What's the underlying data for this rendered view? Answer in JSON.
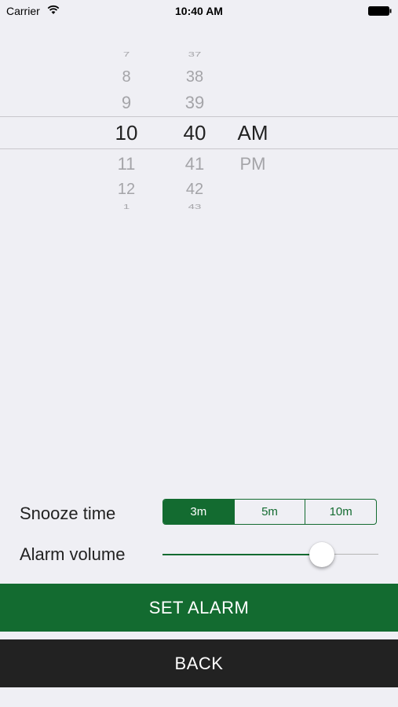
{
  "status_bar": {
    "carrier": "Carrier",
    "time": "10:40 AM"
  },
  "picker": {
    "hours": [
      "7",
      "8",
      "9",
      "10",
      "11",
      "12",
      "1"
    ],
    "minutes": [
      "37",
      "38",
      "39",
      "40",
      "41",
      "42",
      "43"
    ],
    "periods": [
      "AM",
      "PM"
    ],
    "selected": {
      "hour": "10",
      "minute": "40",
      "period": "AM"
    }
  },
  "snooze": {
    "label": "Snooze time",
    "options": [
      "3m",
      "5m",
      "10m"
    ],
    "selected": "3m"
  },
  "volume": {
    "label": "Alarm volume",
    "value": 0.77
  },
  "buttons": {
    "set_alarm": "SET ALARM",
    "back": "BACK"
  },
  "colors": {
    "accent": "#136b30",
    "back_button": "#222222",
    "background": "#efeff4"
  }
}
